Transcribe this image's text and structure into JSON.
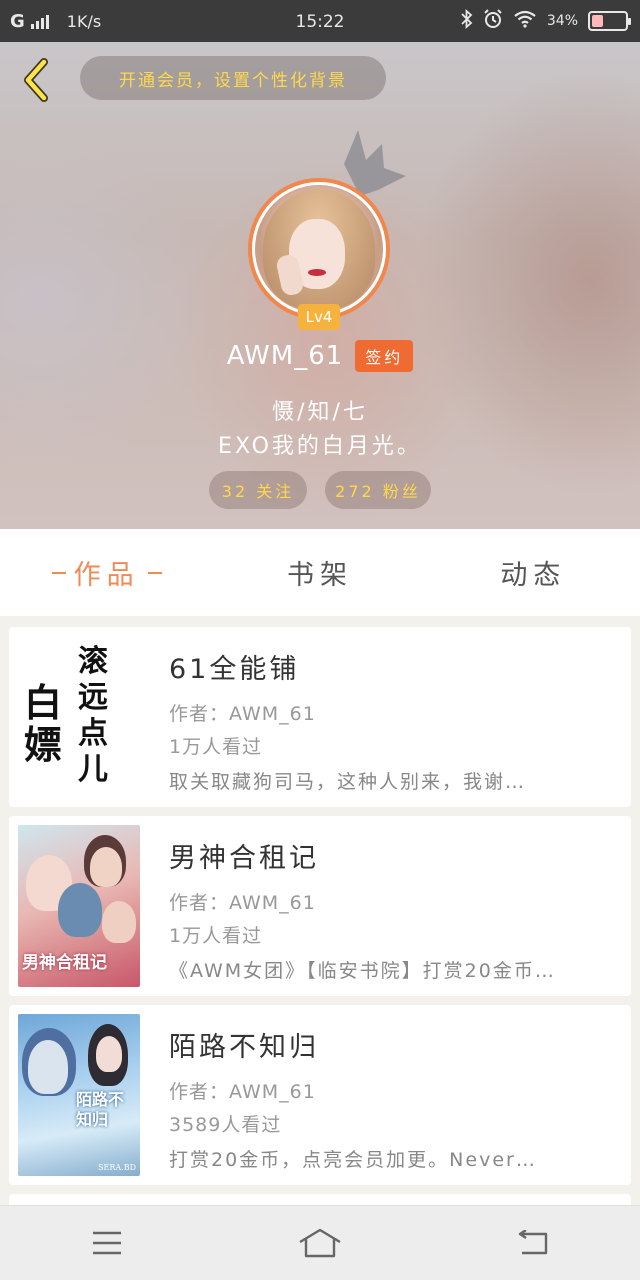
{
  "status_bar": {
    "carrier": "G",
    "speed": "1K/s",
    "time": "15:22",
    "battery": "34%",
    "battery_level": 0.34
  },
  "header": {
    "vip_prompt": "开通会员，设置个性化背景",
    "level": "Lv4",
    "username": "AWM_61",
    "sign_badge": "签约",
    "bio_line1": "慑/知/七",
    "bio_line2": "EXO我的白月光。",
    "follow": "32 关注",
    "fans": "272 粉丝"
  },
  "tabs": [
    {
      "label": "作品",
      "active": true
    },
    {
      "label": "书架",
      "active": false
    },
    {
      "label": "动态",
      "active": false
    }
  ],
  "works": [
    {
      "title": "61全能铺",
      "author": "作者：AWM_61",
      "views": "1万人看过",
      "desc": "取关取藏狗司马，这种人别来，我谢…",
      "cover_text": {
        "big": "白嫖",
        "small": "滚远点儿"
      }
    },
    {
      "title": "男神合租记",
      "author": "作者：AWM_61",
      "views": "1万人看过",
      "desc": "《AWM女团》【临安书院】打赏20金币…",
      "cover_text": {
        "label": "男神合租记"
      }
    },
    {
      "title": "陌路不知归",
      "author": "作者：AWM_61",
      "views": "3589人看过",
      "desc": "打赏20金币，点亮会员加更。Never…",
      "cover_text": {
        "label": "陌路不知归",
        "credit": "SERA.BD"
      }
    }
  ],
  "colors": {
    "accent": "#f08a56",
    "gold": "#ffd84a",
    "sign_badge": "#f06b32",
    "level_badge": "#f5b23c"
  },
  "icons": {
    "back": "chevron-left-icon",
    "crown": "crown-icon",
    "menu": "menu-icon",
    "home": "home-icon",
    "return": "return-icon"
  }
}
